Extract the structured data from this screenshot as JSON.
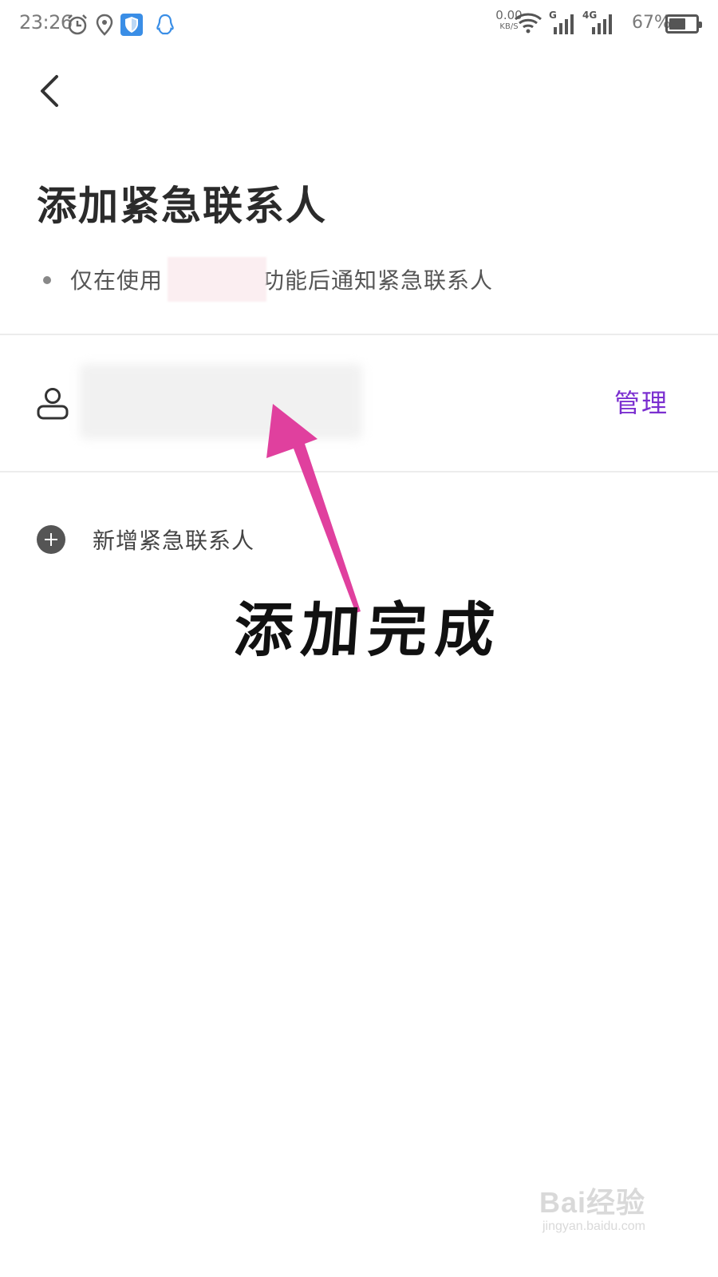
{
  "status_bar": {
    "time": "23:26",
    "net_speed_value": "0.00",
    "net_speed_unit": "KB/S",
    "sim1_label": "G",
    "sim2_label": "4G",
    "battery_percent": "67%",
    "battery_level": 0.67,
    "icons": [
      "alarm-icon",
      "location-icon",
      "shield-app-icon",
      "qq-icon",
      "wifi-icon",
      "signal-icon",
      "battery-icon"
    ]
  },
  "header": {
    "title": "添加紧急联系人",
    "notice_prefix": "仅在使用",
    "notice_suffix": "功能后通知紧急联系人"
  },
  "contact": {
    "manage_label": "管理"
  },
  "add_contact": {
    "label": "新增紧急联系人"
  },
  "annotation": {
    "text": "添加完成",
    "arrow_color": "#e0409e"
  },
  "watermark": {
    "main": "Bai经验",
    "sub": "jingyan.baidu.com"
  },
  "colors": {
    "accent": "#7b2fd0",
    "shield_blue": "#3a8ee6"
  }
}
